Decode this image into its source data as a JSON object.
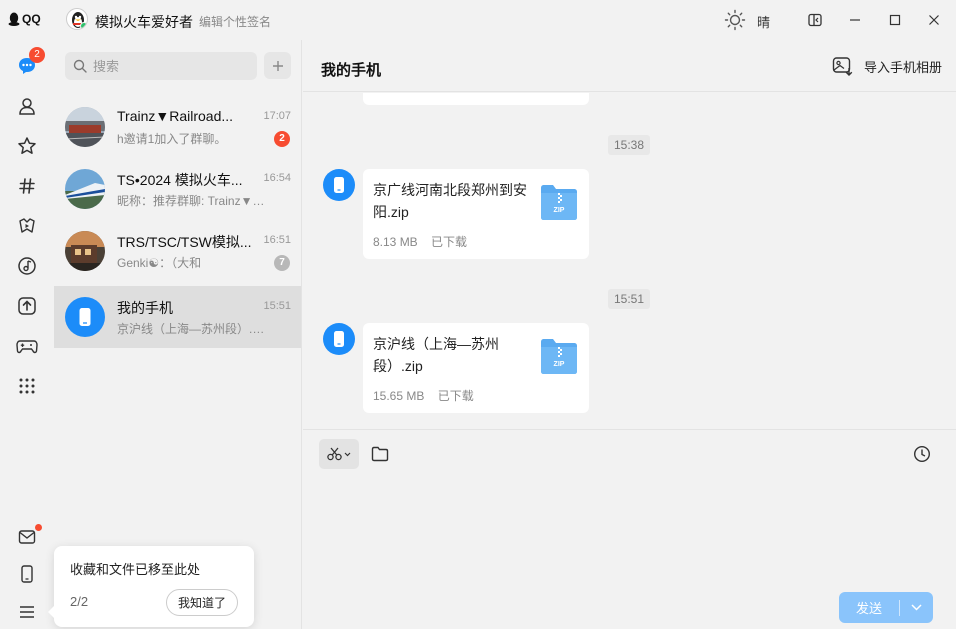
{
  "app": {
    "name": "QQ"
  },
  "titlebar": {
    "nickname": "模拟火车爱好者",
    "signature": "编辑个性签名",
    "weather": "晴"
  },
  "nav": {
    "messages_badge": "2",
    "accent": "#1c8cf9",
    "badge_color": "#f74c31"
  },
  "search": {
    "placeholder": "搜索"
  },
  "conversations": [
    {
      "name": "Trainz▼Railroad...",
      "preview": "h邀请1加入了群聊。",
      "time": "17:07",
      "count": "2"
    },
    {
      "name": "TS•2024 模拟火车...",
      "preview": "昵称：推荐群聊: Trainz▼Railr...",
      "time": "16:54"
    },
    {
      "name": "TRS/TSC/TSW模拟...",
      "preview": "Genki☯：（大和",
      "time": "16:51",
      "count": "7"
    },
    {
      "name": "我的手机",
      "preview": "京沪线（上海—苏州段）.zip",
      "time": "15:51"
    }
  ],
  "tip": {
    "text": "收藏和文件已移至此处",
    "page": "2/2",
    "button": "我知道了"
  },
  "chat": {
    "title": "我的手机",
    "import_label": "导入手机相册",
    "messages": [
      {
        "timestamp": "15:38",
        "file_name": "京广线河南北段郑州到安阳.zip",
        "size": "8.13 MB",
        "status": "已下载"
      },
      {
        "timestamp": "15:51",
        "file_name": "京沪线（上海—苏州段）.zip",
        "size": "15.65 MB",
        "status": "已下载"
      }
    ],
    "zip_label": "ZIP",
    "send_label": "发送"
  }
}
